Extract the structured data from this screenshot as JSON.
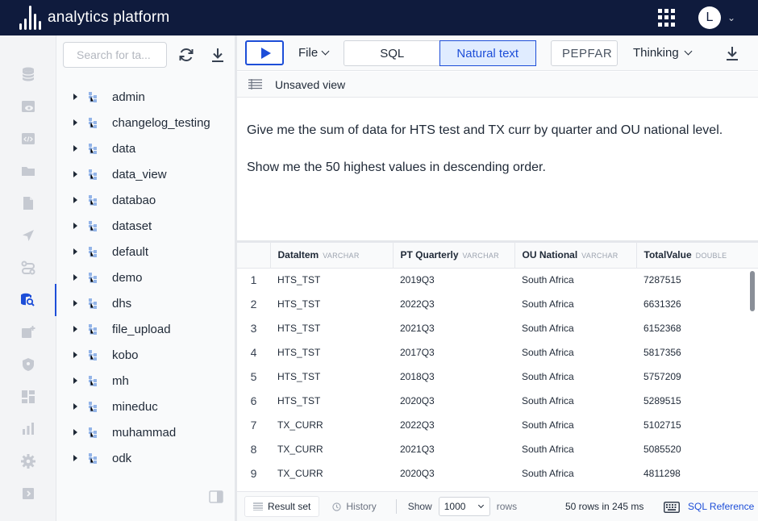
{
  "app": {
    "title": "analytics platform",
    "user_initial": "L"
  },
  "rail": {
    "items": [
      {
        "name": "database-icon"
      },
      {
        "name": "view-icon"
      },
      {
        "name": "code-icon"
      },
      {
        "name": "folder-icon"
      },
      {
        "name": "document-icon"
      },
      {
        "name": "send-icon"
      },
      {
        "name": "workflow-icon"
      },
      {
        "name": "data-explorer-icon",
        "active": true
      },
      {
        "name": "add-item-icon"
      },
      {
        "name": "shield-icon"
      },
      {
        "name": "dashboard-icon"
      },
      {
        "name": "bar-chart-icon"
      },
      {
        "name": "settings-icon"
      },
      {
        "name": "collapse-sidebar-icon"
      }
    ]
  },
  "schema": {
    "search_placeholder": "Search for ta...",
    "items": [
      {
        "label": "admin"
      },
      {
        "label": "changelog_testing"
      },
      {
        "label": "data"
      },
      {
        "label": "data_view"
      },
      {
        "label": "databao"
      },
      {
        "label": "dataset"
      },
      {
        "label": "default"
      },
      {
        "label": "demo"
      },
      {
        "label": "dhs"
      },
      {
        "label": "file_upload"
      },
      {
        "label": "kobo"
      },
      {
        "label": "mh"
      },
      {
        "label": "mineduc"
      },
      {
        "label": "muhammad"
      },
      {
        "label": "odk"
      }
    ]
  },
  "toolbar": {
    "file_label": "File",
    "mode_sql": "SQL",
    "mode_natural": "Natural text",
    "database": "PEPFAR",
    "thinking_label": "Thinking"
  },
  "view": {
    "title": "Unsaved view"
  },
  "editor": {
    "line1": "Give me the sum of data for HTS test and TX curr by quarter and OU national level.",
    "line2": "Show me the 50 highest values in descending order."
  },
  "results": {
    "columns": [
      {
        "name": "DataItem",
        "type": "VARCHAR"
      },
      {
        "name": "PT Quarterly",
        "type": "VARCHAR"
      },
      {
        "name": "OU National",
        "type": "VARCHAR"
      },
      {
        "name": "TotalValue",
        "type": "DOUBLE"
      }
    ],
    "rows": [
      [
        "1",
        "HTS_TST",
        "2019Q3",
        "South Africa",
        "7287515"
      ],
      [
        "2",
        "HTS_TST",
        "2022Q3",
        "South Africa",
        "6631326"
      ],
      [
        "3",
        "HTS_TST",
        "2021Q3",
        "South Africa",
        "6152368"
      ],
      [
        "4",
        "HTS_TST",
        "2017Q3",
        "South Africa",
        "5817356"
      ],
      [
        "5",
        "HTS_TST",
        "2018Q3",
        "South Africa",
        "5757209"
      ],
      [
        "6",
        "HTS_TST",
        "2020Q3",
        "South Africa",
        "5289515"
      ],
      [
        "7",
        "TX_CURR",
        "2022Q3",
        "South Africa",
        "5102715"
      ],
      [
        "8",
        "TX_CURR",
        "2021Q3",
        "South Africa",
        "5085520"
      ],
      [
        "9",
        "TX_CURR",
        "2020Q3",
        "South Africa",
        "4811298"
      ]
    ]
  },
  "status": {
    "result_tab": "Result set",
    "history_tab": "History",
    "show_label": "Show",
    "rows_value": "1000",
    "rows_label": "rows",
    "rows_info": "50 rows in 245 ms",
    "sql_reference": "SQL Reference"
  }
}
